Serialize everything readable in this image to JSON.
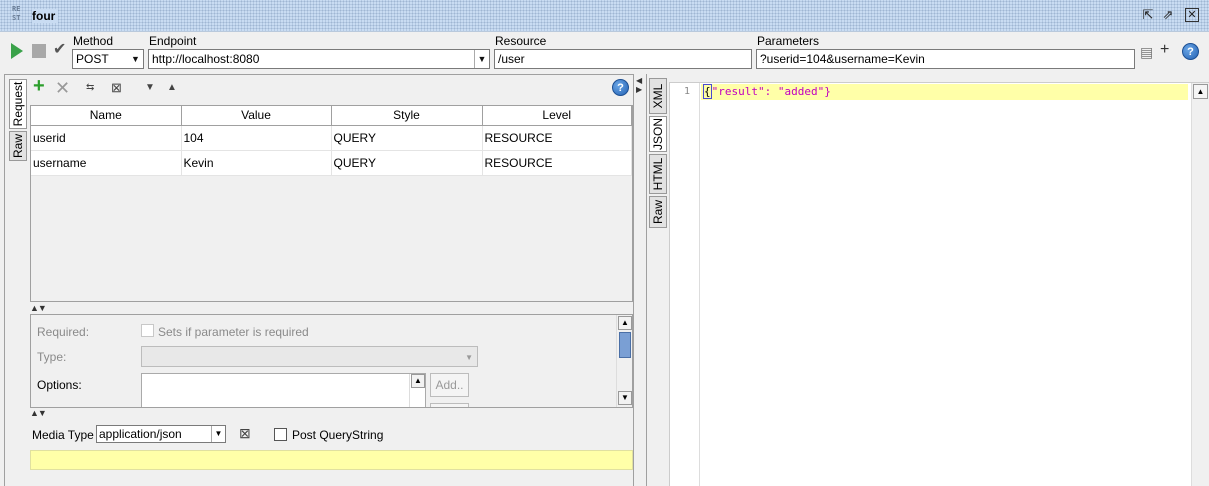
{
  "window": {
    "logo_text": "RE ST",
    "title": "four",
    "detach_icon": "detach-icon",
    "maximize_icon": "maximize-icon",
    "close_icon": "close-icon"
  },
  "toolbar": {
    "method_label": "Method",
    "method_value": "POST",
    "endpoint_label": "Endpoint",
    "endpoint_value": "http://localhost:8080",
    "resource_label": "Resource",
    "resource_value": "/user",
    "parameters_label": "Parameters",
    "parameters_value": "?userid=104&username=Kevin",
    "play_color": "#3aa24a"
  },
  "request_tabs": [
    "Request",
    "Raw"
  ],
  "params_table": {
    "columns": [
      "Name",
      "Value",
      "Style",
      "Level"
    ],
    "rows": [
      [
        "userid",
        "104",
        "QUERY",
        "RESOURCE"
      ],
      [
        "username",
        "Kevin",
        "QUERY",
        "RESOURCE"
      ]
    ]
  },
  "detail": {
    "required_label": "Required:",
    "required_checkbox_label": "Sets if parameter is required",
    "type_label": "Type:",
    "options_label": "Options:",
    "add_button": "Add.."
  },
  "media": {
    "label": "Media Type",
    "value": "application/json",
    "post_querystring_label": "Post QueryString"
  },
  "response_tabs": [
    "XML",
    "JSON",
    "HTML",
    "Raw"
  ],
  "response": {
    "line_number": "1",
    "open_brace": "{",
    "body": "\"result\": \"added\"}"
  },
  "colors": {
    "highlight": "#ffffa8",
    "json_string": "#c000c0"
  }
}
